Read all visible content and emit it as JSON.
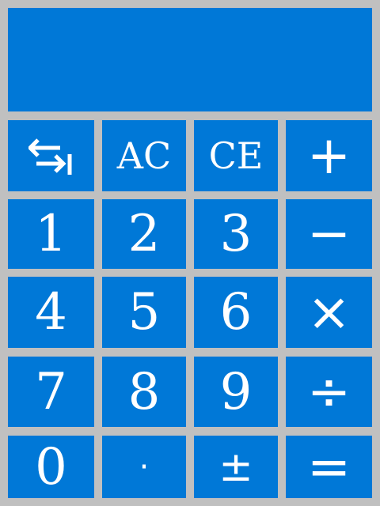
{
  "display": {
    "value": ""
  },
  "keys": {
    "swap_icon": "swap-arrows-icon",
    "ac": "AC",
    "ce": "CE",
    "plus": "+",
    "one": "1",
    "two": "2",
    "three": "3",
    "minus": "−",
    "four": "4",
    "five": "5",
    "six": "6",
    "multiply": "×",
    "seven": "7",
    "eight": "8",
    "nine": "9",
    "divide": "÷",
    "zero": "0",
    "decimal": "·",
    "plus_minus": "±",
    "equals": "="
  },
  "colors": {
    "key_background": "#0078d7",
    "frame_background": "#c0c0c0",
    "key_text": "#ffffff"
  }
}
